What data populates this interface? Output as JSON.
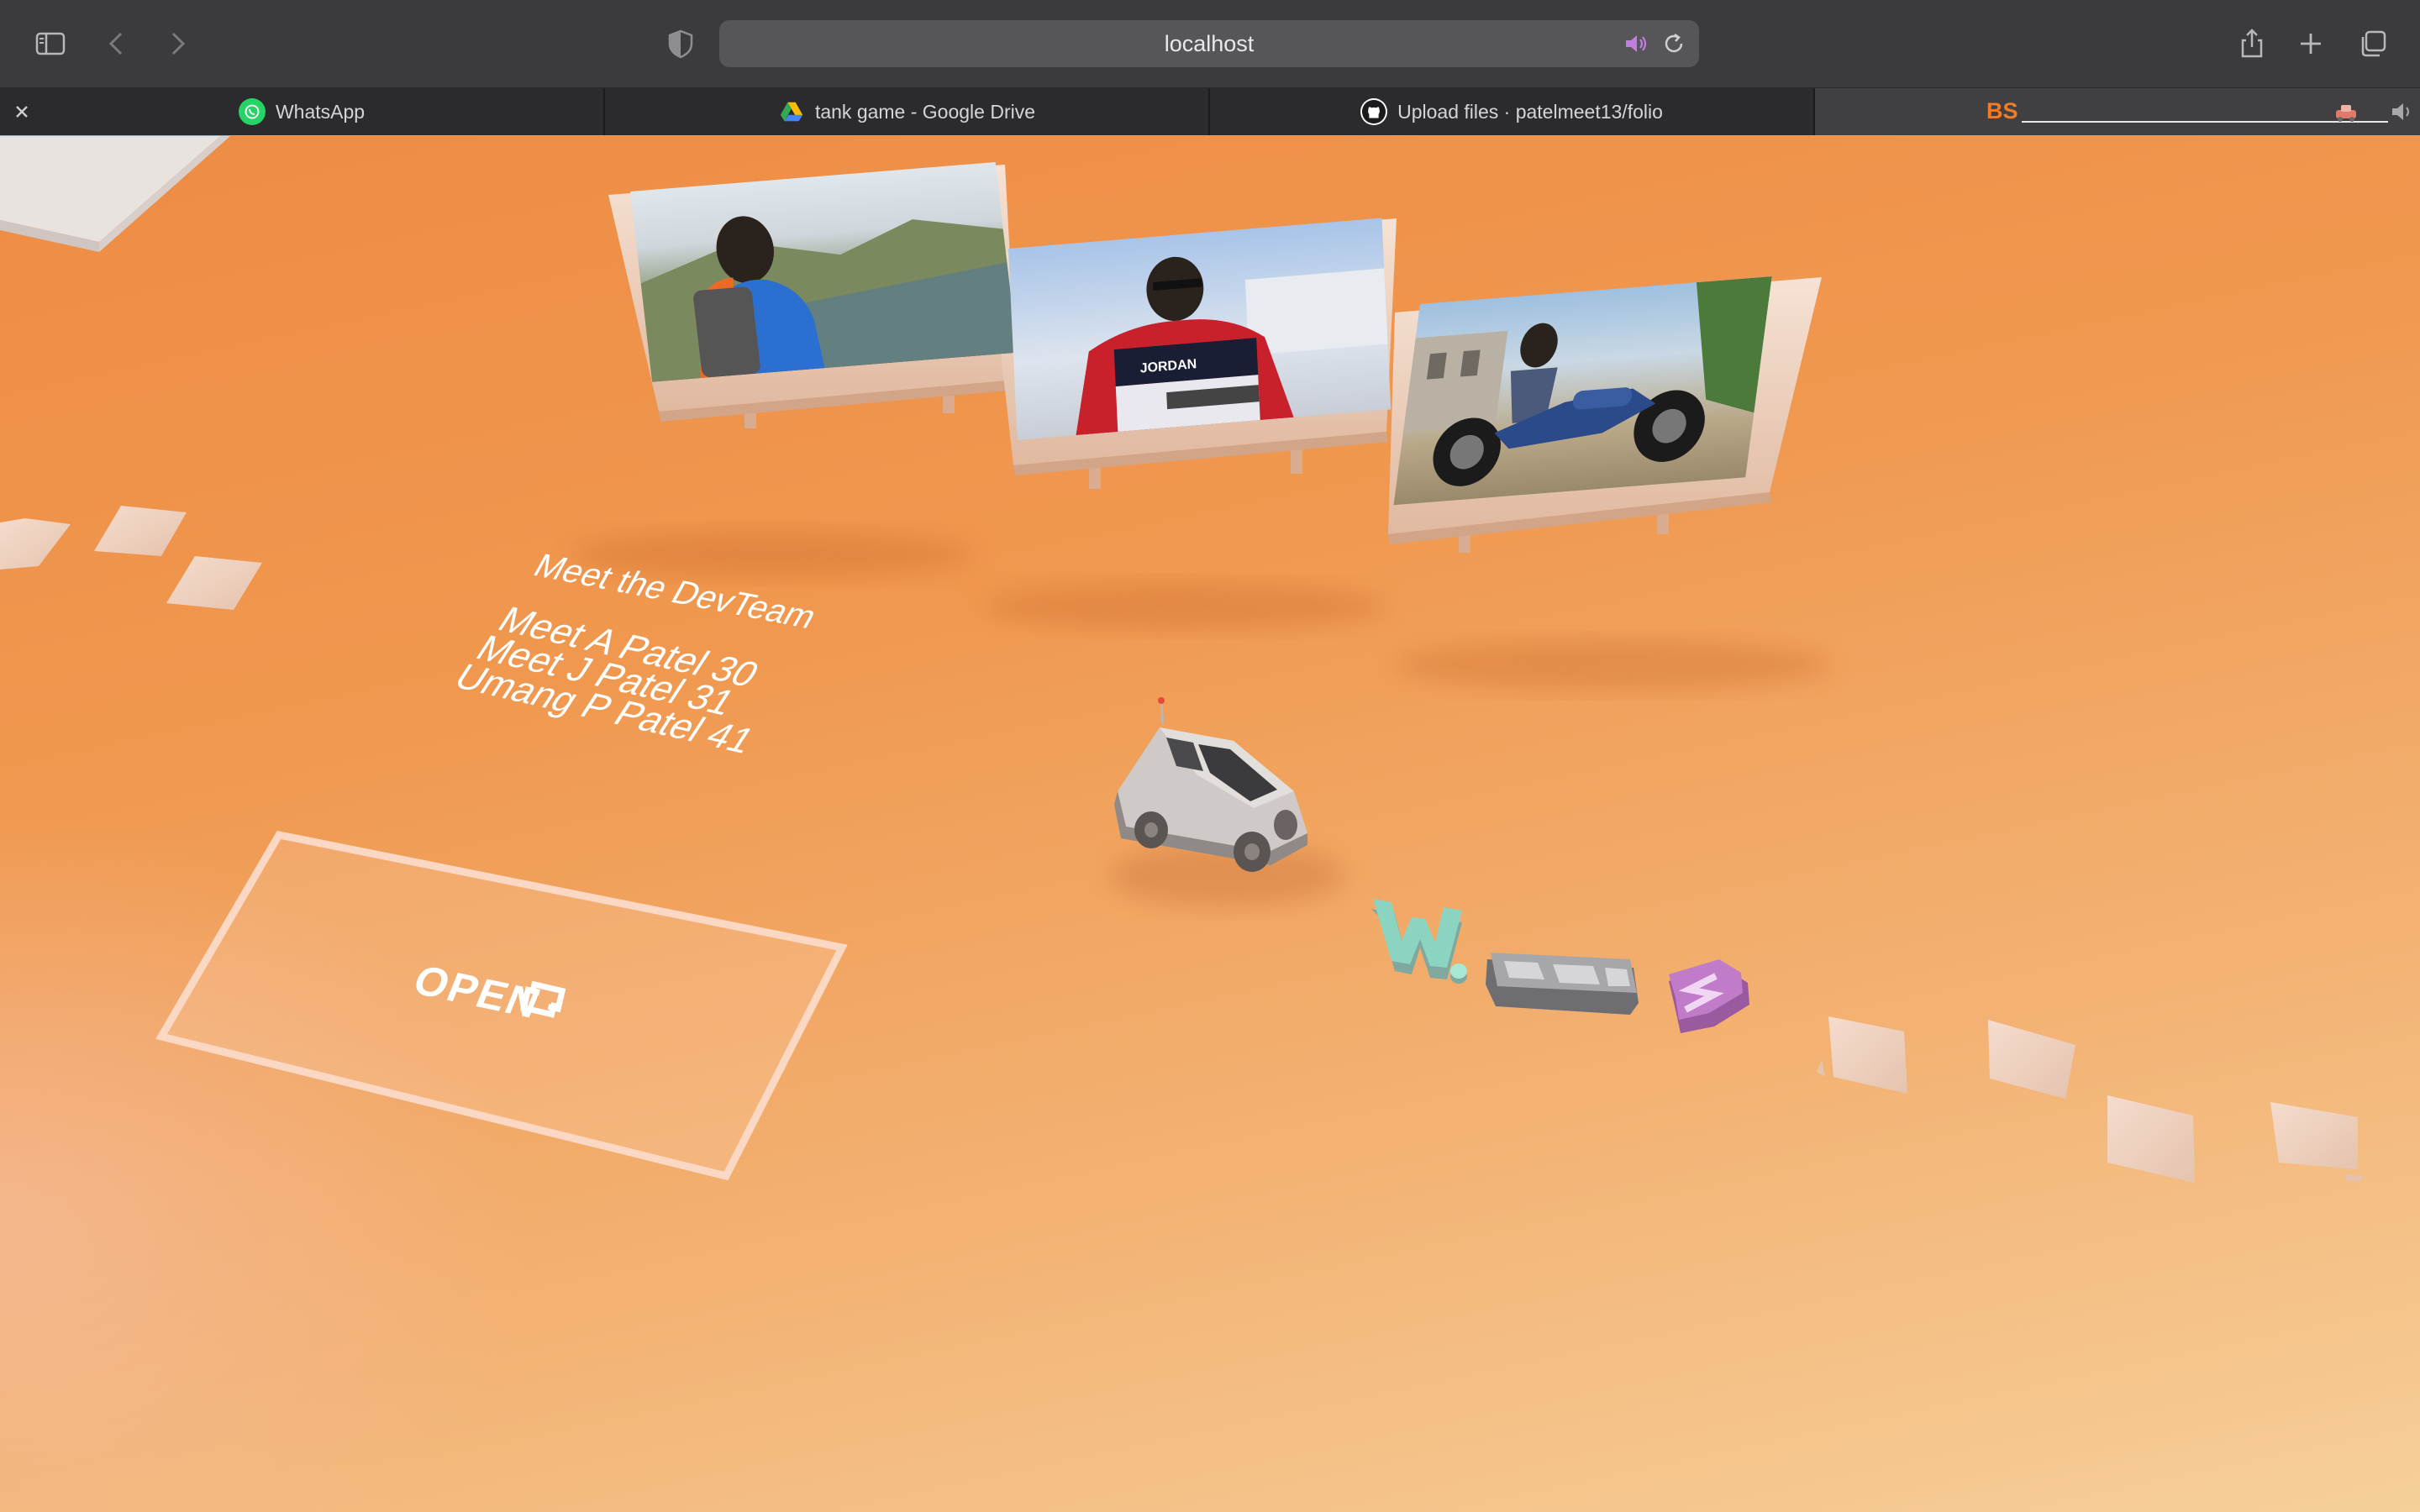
{
  "browser": {
    "url": "localhost",
    "tabs": [
      {
        "label": "WhatsApp",
        "icon": "whatsapp-icon"
      },
      {
        "label": "tank game - Google Drive",
        "icon": "google-drive-icon"
      },
      {
        "label": "Upload files · patelmeet13/folio",
        "icon": "github-icon"
      },
      {
        "label": "BS",
        "icon": "bs-favicon"
      }
    ],
    "accent": "#ef9a57"
  },
  "scene": {
    "team_heading": "Meet the DevTeam",
    "team_members": [
      "Meet A Patel 30",
      "Meet J Patel 31",
      "Umang P Patel 41"
    ],
    "open_label": "OPEN",
    "photos": [
      "photo-hiker",
      "photo-jordan-jacket",
      "photo-motorcycle"
    ],
    "block_letters": [
      "W.",
      "PWA",
      "S"
    ],
    "colors": {
      "ground_top": "#ee8c45",
      "ground_bottom": "#f6cf99",
      "frame": "#efd0bb",
      "tile": "#f0d3c3"
    }
  }
}
